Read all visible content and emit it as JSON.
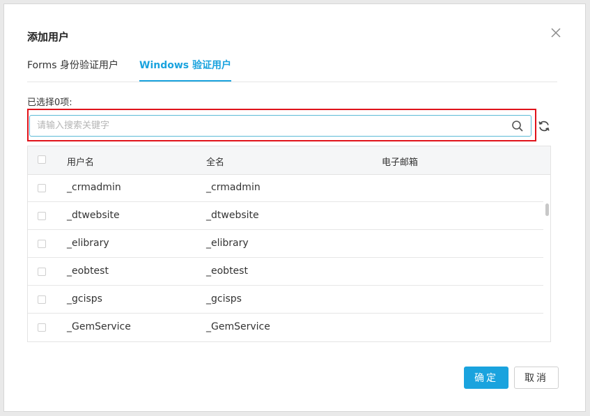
{
  "dialog": {
    "title": "添加用户",
    "close_icon": "close-icon"
  },
  "tabs": [
    {
      "label": "Forms 身份验证用户",
      "active": false
    },
    {
      "label": "Windows 验证用户",
      "active": true
    }
  ],
  "selection": {
    "label": "已选择0项:"
  },
  "search": {
    "placeholder": "请输入搜索关键字",
    "value": "",
    "icon": "search-icon",
    "refresh_icon": "refresh-icon"
  },
  "table": {
    "columns": [
      "用户名",
      "全名",
      "电子邮箱"
    ],
    "rows": [
      {
        "username": "_crmadmin",
        "fullname": "_crmadmin",
        "email": ""
      },
      {
        "username": "_dtwebsite",
        "fullname": "_dtwebsite",
        "email": ""
      },
      {
        "username": "_elibrary",
        "fullname": "_elibrary",
        "email": ""
      },
      {
        "username": "_eobtest",
        "fullname": "_eobtest",
        "email": ""
      },
      {
        "username": "_gcisps",
        "fullname": "_gcisps",
        "email": ""
      },
      {
        "username": "_GemService",
        "fullname": "_GemService",
        "email": ""
      }
    ]
  },
  "footer": {
    "ok_label": "确定",
    "cancel_label": "取消"
  },
  "colors": {
    "accent": "#1aa3de",
    "highlight": "#e0121a"
  }
}
